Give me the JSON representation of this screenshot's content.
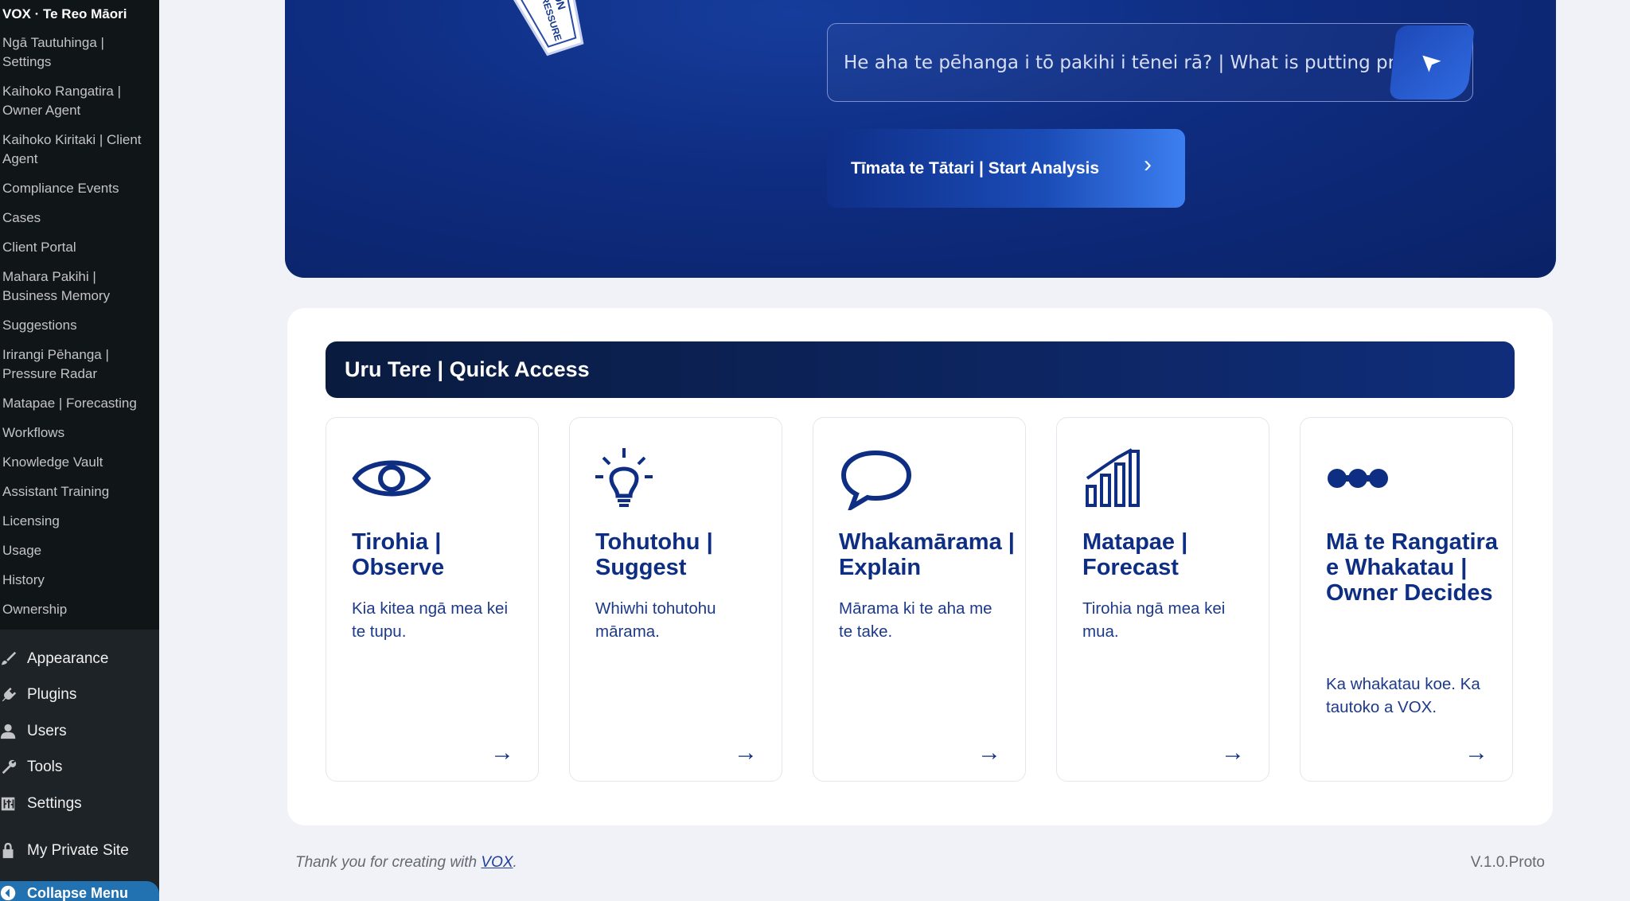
{
  "sidebar": {
    "submenu_head": "VOX · Te Reo Māori",
    "submenu_items": [
      "Ngā Tautuhinga | Settings",
      "Kaihoko Rangatira | Owner Agent",
      "Kaihoko Kiritaki | Client Agent",
      "Compliance Events",
      "Cases",
      "Client Portal",
      "Mahara Pakihi | Business Memory",
      "Suggestions",
      "Irirangi Pēhanga | Pressure Radar",
      "Matapae | Forecasting",
      "Workflows",
      "Knowledge Vault",
      "Assistant Training",
      "Licensing",
      "Usage",
      "History",
      "Ownership"
    ],
    "menu": {
      "appearance": "Appearance",
      "plugins": "Plugins",
      "users": "Users",
      "tools": "Tools",
      "settings": "Settings",
      "private_site": "My Private Site",
      "collapse": "Collapse Menu"
    }
  },
  "hero": {
    "sticker_text_1": "NION",
    "sticker_text_2": "R PRESSURE",
    "prompt_placeholder": "He aha te pēhanga i tō pakihi i tēnei rā? | What is putting pressure on your business today?",
    "start_button": "Tīmata te Tātari | Start Analysis"
  },
  "quick_access": {
    "title": "Uru Tere | Quick Access",
    "cards": [
      {
        "icon": "eye-icon",
        "title": "Tirohia | Observe",
        "desc": "Kia kitea ngā mea kei te tupu."
      },
      {
        "icon": "lightbulb-icon",
        "title": "Tohutohu | Suggest",
        "desc": "Whiwhi tohutohu mārama."
      },
      {
        "icon": "speech-bubble-icon",
        "title": "Whakamārama | Explain",
        "desc": "Mārama ki te aha me te take."
      },
      {
        "icon": "bar-chart-icon",
        "title": "Matapae | Forecast",
        "desc": "Tirohia ngā mea kei mua."
      },
      {
        "icon": "dots-icon",
        "title": "Mā te Rangatira e Whakatau | Owner Decides",
        "desc": "Ka whakatau koe. Ka tautoko a VOX."
      }
    ],
    "arrow": "→"
  },
  "footer": {
    "thanks_prefix": "Thank you for creating with ",
    "thanks_link": "VOX",
    "thanks_suffix": ".",
    "version": "V.1.0.Proto"
  },
  "colors": {
    "sidebar_bg": "#1d2327",
    "hero_blue": "#0e2c80",
    "accent": "#2271b1",
    "card_text": "#0e2e84"
  }
}
